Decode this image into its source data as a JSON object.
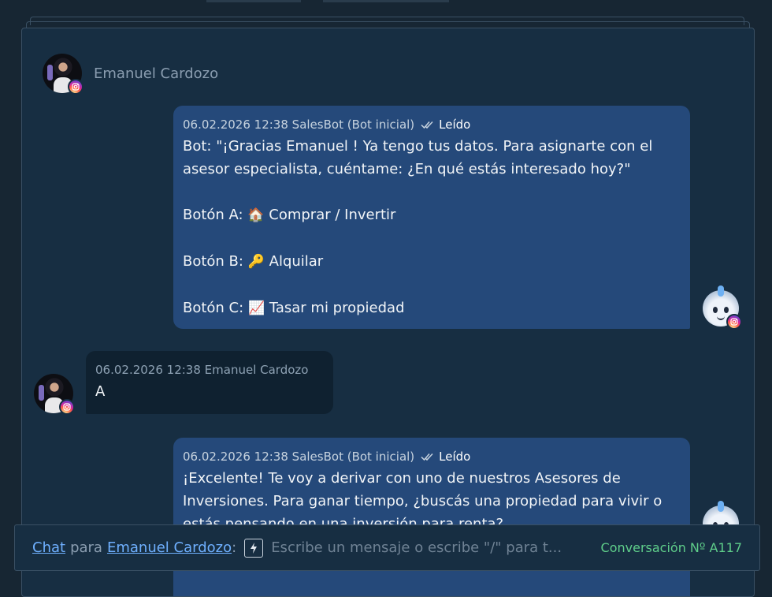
{
  "contact": {
    "name": "Emanuel Cardozo"
  },
  "messages": [
    {
      "direction": "outgoing",
      "timestamp": "06.02.2026 12:38",
      "sender": "SalesBot (Bot inicial)",
      "status": "Leído",
      "lines": {
        "l1": "Bot: \"¡Gracias Emanuel ! Ya tengo tus datos. Para asignarte con el",
        "l2": "asesor especialista, cuéntame: ¿En qué estás interesado hoy?\"",
        "opt_a_label": "Botón A:",
        "opt_a_emoji": "🏠",
        "opt_a_text": "Comprar / Invertir",
        "opt_b_label": "Botón B:",
        "opt_b_emoji": "🔑",
        "opt_b_text": "Alquilar",
        "opt_c_label": "Botón C:",
        "opt_c_emoji": "📈",
        "opt_c_text": "Tasar mi propiedad"
      }
    },
    {
      "direction": "incoming",
      "timestamp": "06.02.2026 12:38",
      "sender": "Emanuel Cardozo",
      "text": "A"
    },
    {
      "direction": "outgoing",
      "timestamp": "06.02.2026 12:38",
      "sender": "SalesBot (Bot inicial)",
      "status": "Leído",
      "lines": {
        "l1": "¡Excelente! Te voy a derivar con uno de nuestros Asesores de",
        "l2": "Inversiones. Para ganar tiempo, ¿buscás una propiedad para vivir o",
        "l3": "estás pensando en una inversión para renta?"
      }
    }
  ],
  "composer": {
    "channel_link": "Chat",
    "para": "para",
    "recipient_link": "Emanuel Cardozo",
    "colon": ":",
    "placeholder": "Escribe un mensaje o escribe \"/\" para t...",
    "conversation_id": "Conversación Nº A117"
  },
  "icons": {
    "badge": "instagram-icon",
    "read": "double-check-icon",
    "quick_reply": "lightning-icon"
  },
  "colors": {
    "background": "#172633",
    "bot_bubble": "#25497a",
    "user_bubble": "#0f2130",
    "link": "#6fb0ff",
    "conversation_id": "#5fce8a"
  }
}
